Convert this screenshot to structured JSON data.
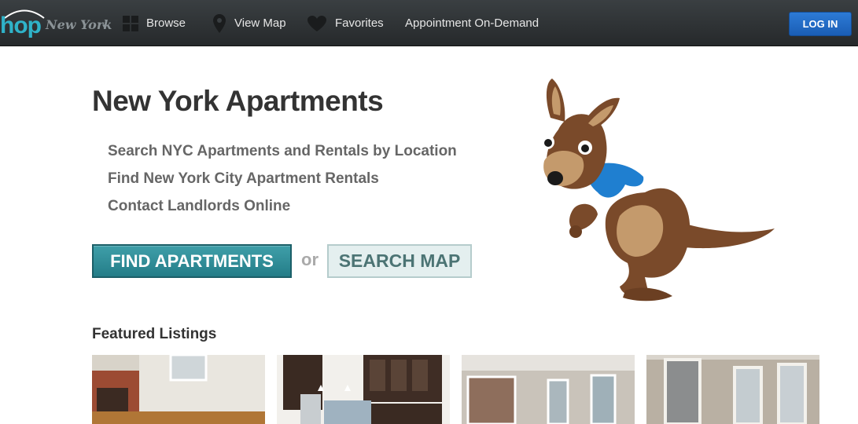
{
  "brand": {
    "logo_text": "hop",
    "city": "New York"
  },
  "nav": {
    "items": [
      {
        "label": "Browse",
        "icon": "grid-icon"
      },
      {
        "label": "View Map",
        "icon": "map-pin-icon"
      },
      {
        "label": "Favorites",
        "icon": "heart-icon"
      },
      {
        "label": "Appointment On-Demand"
      }
    ],
    "login_label": "LOG IN"
  },
  "hero": {
    "title": "New York Apartments",
    "subtitles": [
      "Search NYC Apartments and Rentals by Location",
      "Find New York City Apartment Rentals",
      "Contact Landlords Online"
    ],
    "find_button": "FIND APARTMENTS",
    "or_text": "or",
    "search_map_button": "SEARCH MAP",
    "mascot": "kangaroo-mascot"
  },
  "featured": {
    "title": "Featured Listings",
    "listings": [
      {
        "image": "living-room-fireplace-photo"
      },
      {
        "image": "kitchen-photo"
      },
      {
        "image": "empty-room-windows-photo"
      },
      {
        "image": "bedroom-windows-photo"
      }
    ]
  },
  "colors": {
    "nav_bg": "#2b2f31",
    "brand_teal": "#2fb3c9",
    "login_blue": "#1f66c2",
    "find_button": "#2f8d98",
    "search_button_bg": "#e4efef"
  }
}
